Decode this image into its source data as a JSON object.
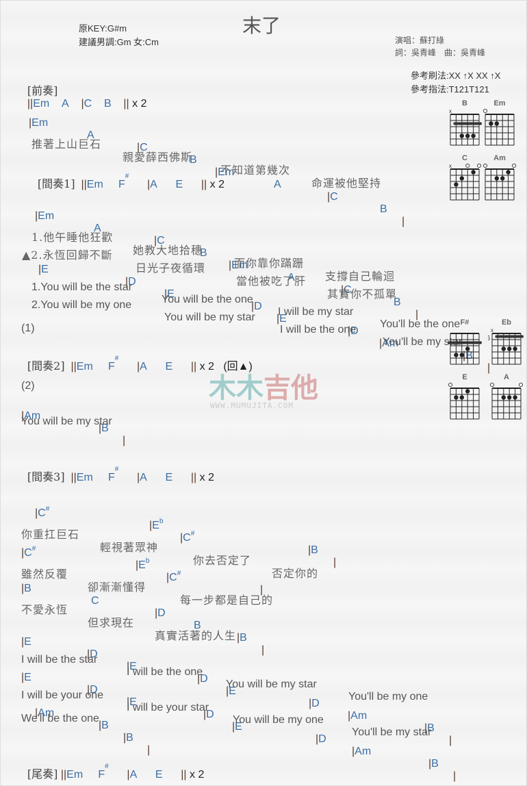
{
  "header": {
    "title": "末了",
    "key": "原KEY:G#m",
    "suggest": "建議男調:Gm 女:Cm",
    "singer": "演唱：蘇打綠",
    "credits": "詞：吳青峰　曲：吳青峰",
    "strum": "參考刷法:XX ↑X XX ↑X",
    "pick": "參考指法:T121T121"
  },
  "lines": {
    "intro_label": "[前奏]",
    "intro": [
      "||",
      "Em",
      "A",
      "|",
      "C",
      "B",
      "||",
      "x 2"
    ],
    "v1_chords": [
      "|",
      "Em",
      "A",
      "|",
      "C",
      "B",
      "|",
      "Em",
      "A",
      "|",
      "C",
      "B",
      "|"
    ],
    "v1_lyric": [
      "推著上山巨石",
      "親愛薛西佛斯",
      "不知道第幾次",
      "命運被他堅持"
    ],
    "inter1_label": "[間奏1]",
    "inter1": [
      "||",
      "Em",
      "F",
      "#",
      "|",
      "A",
      "E",
      "||",
      "x 2"
    ],
    "v2_chords": [
      "|",
      "Em",
      "A",
      "|",
      "C",
      "B",
      "|",
      "Em",
      "A",
      "|",
      "C",
      "B",
      "|"
    ],
    "v2_lyric1": [
      "1.他午睡他狂歡",
      "她教大地拾穗",
      "而你靠你蹣跚",
      "支撐自己輪迴"
    ],
    "v2_lyric2": [
      "▲2.永恆回歸不斷",
      "日光子夜循環",
      "當他被吃了肝",
      "其實你不孤單"
    ],
    "ch1_chords": [
      "|",
      "E",
      "|",
      "D",
      "|",
      "E",
      "|",
      "D",
      "|",
      "E",
      "|",
      "D",
      "|",
      "Am",
      "|",
      "B",
      "|"
    ],
    "ch1_lyric1": [
      "1.You will be the star",
      "You will be the one",
      "I will be my star",
      "You'll be the one"
    ],
    "ch1_lyric2": [
      "2.You will be my one",
      "You will be my star",
      "I will be the one",
      "You'll be my star"
    ],
    "mark1": "(1)",
    "inter2_label": "[間奏2]",
    "inter2": [
      "||",
      "Em",
      "F",
      "#",
      "|",
      "A",
      "E",
      "||",
      "x 2",
      "(回▲)"
    ],
    "mark2": "(2)",
    "end2_chords": [
      "|",
      "Am",
      "|",
      "B",
      "|"
    ],
    "end2_lyric": "You will be my star",
    "inter3_label": "[間奏3]",
    "inter3": [
      "||",
      "Em",
      "F",
      "#",
      "|",
      "A",
      "E",
      "||",
      "x 2"
    ],
    "br1_chords": [
      "|",
      "C",
      "#",
      "|",
      "E",
      "b",
      "|",
      "C",
      "#",
      "|",
      "B",
      "|"
    ],
    "br1_lyric": [
      "你重扛巨石",
      "輕視著眾神",
      "你去否定了",
      "否定你的"
    ],
    "br2_chords": [
      "|",
      "C",
      "#",
      "|",
      "E",
      "b",
      "|",
      "C",
      "#",
      "|"
    ],
    "br2_lyric": [
      "雖然反覆",
      "卻漸漸懂得",
      "每一步都是自己的"
    ],
    "br3_chords": [
      "|",
      "B",
      "C",
      "|",
      "D",
      "B",
      "|",
      "B",
      "|"
    ],
    "br3_lyric": [
      "不愛永恆",
      "但求現在",
      "真實活著的人生"
    ],
    "ch2_chords": [
      "|",
      "E",
      "|",
      "D",
      "|",
      "E",
      "|",
      "D",
      "|",
      "E",
      "|",
      "D",
      "|",
      "Am",
      "|",
      "B",
      "|"
    ],
    "ch2_lyric": [
      "I will be the star",
      "I will be the one",
      "You will be my star",
      "You'll be my one"
    ],
    "ch3_chords": [
      "|",
      "E",
      "|",
      "D",
      "|",
      "E",
      "|",
      "D",
      "|",
      "E",
      "|",
      "D",
      "|",
      "Am",
      "|",
      "B",
      "|"
    ],
    "ch3_lyric": [
      "I will be your one",
      "I will be your star",
      "You will be my one",
      "You'll be my star"
    ],
    "ch4_chords": [
      "|",
      "Am",
      "|",
      "B",
      "|",
      "B",
      "|"
    ],
    "ch4_lyric": "We'll be the one",
    "outro_label": "[尾奏]",
    "outro": [
      "||",
      "Em",
      "F",
      "#",
      "|",
      "A",
      "E",
      "||",
      "x 2"
    ]
  },
  "chord_diagrams": [
    {
      "name": "B",
      "top": [
        "x",
        "",
        "",
        "",
        "",
        ""
      ],
      "barre": {
        "fret": 2,
        "from": 1,
        "to": 5
      },
      "dots": [
        [
          2,
          4
        ],
        [
          3,
          4
        ],
        [
          4,
          4
        ]
      ],
      "fret_label": ""
    },
    {
      "name": "Em",
      "top": [
        "o",
        "",
        "",
        "",
        "",
        ""
      ],
      "barre": null,
      "dots": [
        [
          1,
          2
        ],
        [
          2,
          2
        ]
      ],
      "fret_label": ""
    },
    {
      "name": "C",
      "top": [
        "x",
        "",
        "",
        "o",
        "",
        "o"
      ],
      "barre": null,
      "dots": [
        [
          1,
          3
        ],
        [
          2,
          2
        ],
        [
          4,
          1
        ]
      ],
      "fret_label": ""
    },
    {
      "name": "Am",
      "top": [
        "o",
        "",
        "",
        "",
        "",
        "o"
      ],
      "barre": null,
      "dots": [
        [
          2,
          2
        ],
        [
          3,
          2
        ],
        [
          4,
          1
        ]
      ],
      "fret_label": ""
    },
    {
      "name": "F#",
      "top": [
        "",
        "",
        "",
        "",
        "",
        ""
      ],
      "barre": {
        "fret": 2,
        "from": 0,
        "to": 5
      },
      "dots": [
        [
          1,
          4
        ],
        [
          2,
          4
        ],
        [
          3,
          3
        ]
      ],
      "fret_label": ""
    },
    {
      "name": "Eb",
      "top": [
        "x",
        "",
        "",
        "",
        "",
        ""
      ],
      "barre": {
        "fret": 1,
        "from": 1,
        "to": 5
      },
      "dots": [
        [
          2,
          3
        ],
        [
          3,
          3
        ],
        [
          4,
          3
        ]
      ],
      "fret_label": "6"
    },
    {
      "name": "E",
      "top": [
        "o",
        "",
        "",
        "",
        "",
        ""
      ],
      "barre": null,
      "dots": [
        [
          1,
          2
        ],
        [
          2,
          2
        ],
        [
          3,
          1
        ]
      ],
      "fret_label": ""
    },
    {
      "name": "A",
      "top": [
        "o",
        "",
        "",
        "",
        "",
        "o"
      ],
      "barre": null,
      "dots": [
        [
          2,
          2
        ],
        [
          3,
          2
        ],
        [
          4,
          2
        ]
      ],
      "fret_label": ""
    }
  ],
  "watermark": {
    "text": "木木吉他",
    "url_text": "WWW.MUMUJITA.COM"
  }
}
